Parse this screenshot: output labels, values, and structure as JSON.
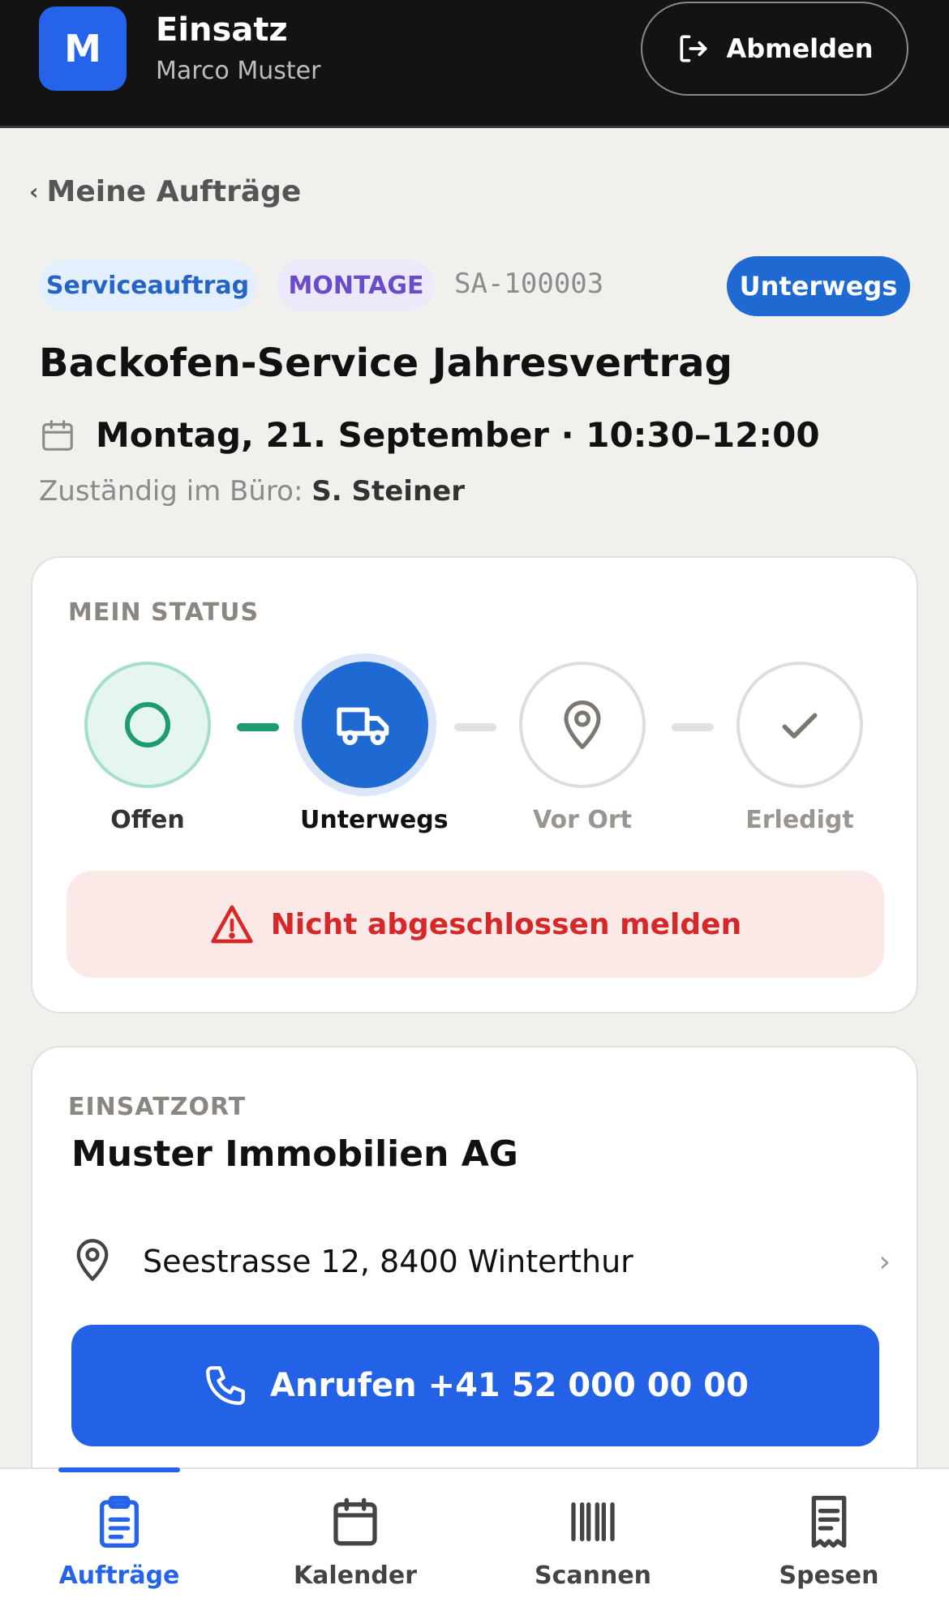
{
  "header": {
    "avatar_letter": "M",
    "app_title": "Einsatz",
    "user_name": "Marco Muster",
    "logout_label": "Abmelden"
  },
  "back_link": {
    "label": "Meine Aufträge"
  },
  "order": {
    "type_tag": "Serviceauftrag",
    "category_tag": "MONTAGE",
    "id": "SA-100003",
    "status": "Unterwegs",
    "title": "Backofen-Service Jahresvertrag",
    "datetime": "Montag, 21. September · 10:30–12:00",
    "responsible_label": "Zuständig im Büro:",
    "responsible_name": "S. Steiner"
  },
  "status_card": {
    "label": "MEIN STATUS",
    "steps": [
      {
        "label": "Offen",
        "state": "done"
      },
      {
        "label": "Unterwegs",
        "state": "current"
      },
      {
        "label": "Vor Ort",
        "state": "pending"
      },
      {
        "label": "Erledigt",
        "state": "pending"
      }
    ],
    "report_label": "Nicht abgeschlossen melden"
  },
  "place_card": {
    "label": "EINSATZORT",
    "name": "Muster Immobilien AG",
    "address": "Seestrasse 12, 8400 Winterthur",
    "call_label": "Anrufen +41 52 000 00 00"
  },
  "bottom_nav": {
    "items": [
      {
        "label": "Aufträge",
        "icon": "clipboard-icon",
        "active": true
      },
      {
        "label": "Kalender",
        "icon": "calendar-icon",
        "active": false
      },
      {
        "label": "Scannen",
        "icon": "barcode-icon",
        "active": false
      },
      {
        "label": "Spesen",
        "icon": "receipt-icon",
        "active": false
      }
    ]
  },
  "colors": {
    "primary": "#2563eb",
    "status_pill": "#1e6ad2",
    "done_green": "#1e9b73",
    "danger": "#d62828",
    "header_bg": "#131313"
  }
}
